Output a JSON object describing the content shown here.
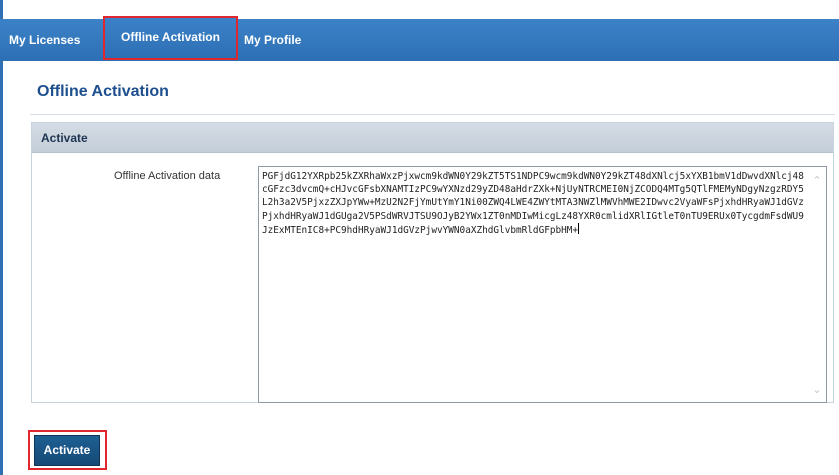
{
  "nav": {
    "tabs": [
      {
        "label": "My Licenses"
      },
      {
        "label": "Offline Activation",
        "active": true
      },
      {
        "label": "My Profile"
      }
    ]
  },
  "page": {
    "title": "Offline Activation"
  },
  "panel": {
    "title": "Activate",
    "field_label": "Offline Activation data",
    "field_value": "PGFjdG12YXRpb25kZXRhaWxzPjxwcm9kdWN0Y29kZT5TS1NDPC9wcm9kdWN0Y29kZT48dXNlcj5xYXB1bmV1dDwvdXNlcj48cGFzc3dvcmQ+cHJvcGFsbXNAMTIzPC9wYXNzd29yZD48aHdrZXk+NjUyNTRCMEI0NjZCODQ4MTg5QTlFMEMyNDgyNzgzRDY5L2h3a2V5PjxzZXJpYWw+MzU2N2FjYmUtYmY1Ni00ZWQ4LWE4ZWYtMTA3NWZlMWVhMWE2IDwvc2VyaWFsPjxhdHRyaWJ1dGVzPjxhdHRyaWJ1dGUga2V5PSdWRVJTSU9OJyB2YWx1ZT0nMDIwMicgLz48YXR0cmlidXRlIGtleT0nTU9ERUx0TycgdmFsdWU9JzExMTEnIC8+PC9hdHRyaWJ1dGVzPjwvYWN0aXZhdGlvbmRldGFpbHM+"
  },
  "actions": {
    "activate_label": "Activate"
  },
  "colors": {
    "nav_blue": "#2f6fb3",
    "highlight_red": "#e0262f",
    "title_blue": "#1d4f8e",
    "button_blue": "#1a5585"
  }
}
